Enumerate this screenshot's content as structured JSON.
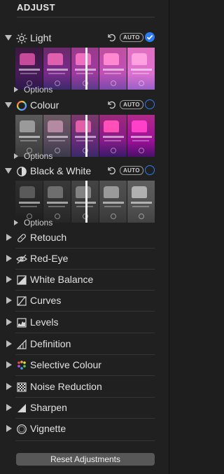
{
  "panel": {
    "title": "ADJUST"
  },
  "sections": {
    "light": {
      "label": "Light",
      "auto": "AUTO",
      "enabled": true,
      "options_label": "Options"
    },
    "colour": {
      "label": "Colour",
      "auto": "AUTO",
      "enabled": false,
      "options_label": "Options"
    },
    "bw": {
      "label": "Black & White",
      "auto": "AUTO",
      "enabled": false,
      "options_label": "Options"
    }
  },
  "tools": [
    {
      "label": "Retouch",
      "icon": "bandage-icon"
    },
    {
      "label": "Red-Eye",
      "icon": "eye-icon"
    },
    {
      "label": "White Balance",
      "icon": "white-balance-icon"
    },
    {
      "label": "Curves",
      "icon": "curves-icon"
    },
    {
      "label": "Levels",
      "icon": "levels-icon"
    },
    {
      "label": "Definition",
      "icon": "definition-icon"
    },
    {
      "label": "Selective Colour",
      "icon": "selective-colour-icon"
    },
    {
      "label": "Noise Reduction",
      "icon": "noise-reduction-icon"
    },
    {
      "label": "Sharpen",
      "icon": "sharpen-icon"
    },
    {
      "label": "Vignette",
      "icon": "vignette-icon"
    }
  ],
  "reset_label": "Reset Adjustments",
  "colors": {
    "accent": "#2e7bf0",
    "background": "#202020"
  }
}
